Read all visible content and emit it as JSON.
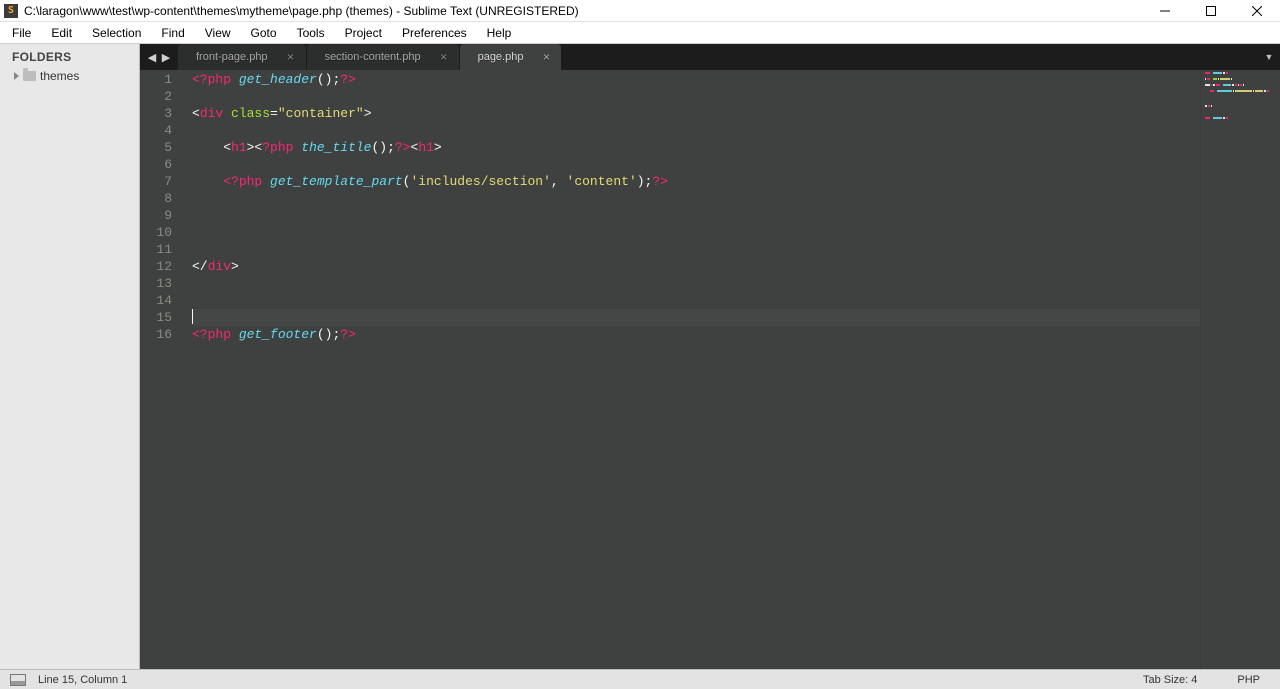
{
  "title": "C:\\laragon\\www\\test\\wp-content\\themes\\mytheme\\page.php (themes) - Sublime Text (UNREGISTERED)",
  "menus": [
    "File",
    "Edit",
    "Selection",
    "Find",
    "View",
    "Goto",
    "Tools",
    "Project",
    "Preferences",
    "Help"
  ],
  "sidebar": {
    "header": "FOLDERS",
    "root": "themes"
  },
  "tabs": [
    {
      "label": "front-page.php",
      "active": false
    },
    {
      "label": "section-content.php",
      "active": false
    },
    {
      "label": "page.php",
      "active": true
    }
  ],
  "code": {
    "lines": [
      {
        "n": 1,
        "tokens": [
          [
            "op",
            "<?php"
          ],
          [
            "pn",
            " "
          ],
          [
            "fn",
            "get_header"
          ],
          [
            "pn",
            "();"
          ],
          [
            "op",
            "?>"
          ]
        ]
      },
      {
        "n": 2,
        "tokens": [
          [
            "pn",
            ""
          ]
        ]
      },
      {
        "n": 3,
        "tokens": [
          [
            "pn",
            "<"
          ],
          [
            "op",
            "div"
          ],
          [
            "pn",
            " "
          ],
          [
            "at",
            "class"
          ],
          [
            "pn",
            "="
          ],
          [
            "st",
            "\"container\""
          ],
          [
            "pn",
            ">"
          ]
        ]
      },
      {
        "n": 4,
        "tokens": [
          [
            "pn",
            ""
          ]
        ]
      },
      {
        "n": 5,
        "tokens": [
          [
            "pn",
            "    <"
          ],
          [
            "op",
            "h1"
          ],
          [
            "pn",
            "><"
          ],
          [
            "op",
            "?php"
          ],
          [
            "pn",
            " "
          ],
          [
            "fn",
            "the_title"
          ],
          [
            "pn",
            "();"
          ],
          [
            "op",
            "?>"
          ],
          [
            "pn",
            "<"
          ],
          [
            "op",
            "h1"
          ],
          [
            "pn",
            ">"
          ]
        ]
      },
      {
        "n": 6,
        "tokens": [
          [
            "pn",
            ""
          ]
        ]
      },
      {
        "n": 7,
        "tokens": [
          [
            "pn",
            "    "
          ],
          [
            "op",
            "<?php"
          ],
          [
            "pn",
            " "
          ],
          [
            "fn",
            "get_template_part"
          ],
          [
            "pn",
            "("
          ],
          [
            "st",
            "'includes/section'"
          ],
          [
            "pn",
            ", "
          ],
          [
            "st",
            "'content'"
          ],
          [
            "pn",
            ");"
          ],
          [
            "op",
            "?>"
          ]
        ]
      },
      {
        "n": 8,
        "tokens": [
          [
            "pn",
            ""
          ]
        ]
      },
      {
        "n": 9,
        "tokens": [
          [
            "pn",
            ""
          ]
        ]
      },
      {
        "n": 10,
        "tokens": [
          [
            "pn",
            ""
          ]
        ]
      },
      {
        "n": 11,
        "tokens": [
          [
            "pn",
            ""
          ]
        ]
      },
      {
        "n": 12,
        "tokens": [
          [
            "pn",
            "</"
          ],
          [
            "op",
            "div"
          ],
          [
            "pn",
            ">"
          ]
        ]
      },
      {
        "n": 13,
        "tokens": [
          [
            "pn",
            ""
          ]
        ]
      },
      {
        "n": 14,
        "tokens": [
          [
            "pn",
            ""
          ]
        ]
      },
      {
        "n": 15,
        "tokens": [
          [
            "pn",
            ""
          ]
        ],
        "active": true
      },
      {
        "n": 16,
        "tokens": [
          [
            "op",
            "<?php"
          ],
          [
            "pn",
            " "
          ],
          [
            "fn",
            "get_footer"
          ],
          [
            "pn",
            "();"
          ],
          [
            "op",
            "?>"
          ]
        ]
      }
    ]
  },
  "status": {
    "cursor": "Line 15, Column 1",
    "tabsize": "Tab Size: 4",
    "syntax": "PHP"
  },
  "colors": {
    "bg": "#3f4140",
    "pink": "#f92672",
    "blue": "#66d9ef",
    "yellow": "#e6db74",
    "green": "#a6e22e",
    "white": "#f8f8f2"
  }
}
